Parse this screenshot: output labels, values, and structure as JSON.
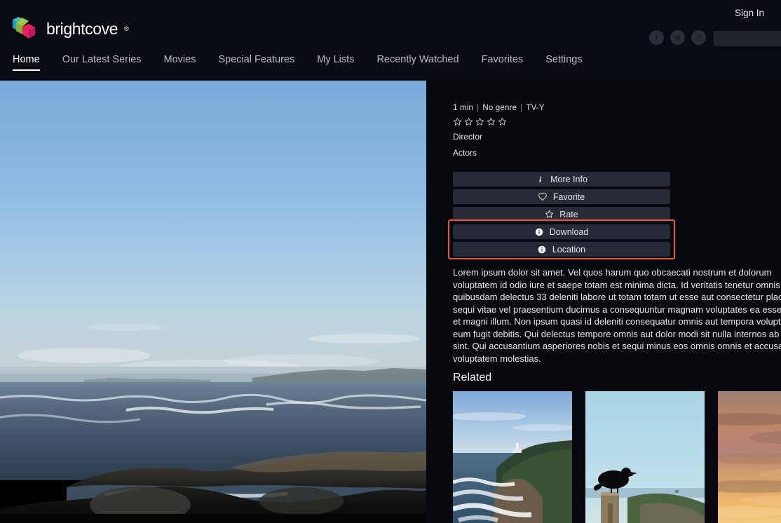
{
  "brand": {
    "name": "brightcove",
    "trademark": "®",
    "logo_colors": {
      "cyan": "#2dbde4",
      "green": "#9dc73c",
      "magenta": "#e61e64"
    }
  },
  "header": {
    "sign_in": "Sign In",
    "social": [
      {
        "name": "facebook-icon",
        "label": "Facebook"
      },
      {
        "name": "twitter-icon",
        "label": "Twitter"
      },
      {
        "name": "instagram-icon",
        "label": "Instagram"
      }
    ],
    "search": {
      "value": "",
      "placeholder": ""
    }
  },
  "nav": {
    "items": [
      {
        "label": "Home",
        "active": true
      },
      {
        "label": "Our Latest Series",
        "active": false
      },
      {
        "label": "Movies",
        "active": false
      },
      {
        "label": "Special Features",
        "active": false
      },
      {
        "label": "My Lists",
        "active": false
      },
      {
        "label": "Recently Watched",
        "active": false
      },
      {
        "label": "Favorites",
        "active": false
      },
      {
        "label": "Settings",
        "active": false
      }
    ]
  },
  "detail": {
    "duration": "1 min",
    "genre": "No genre",
    "rating": "TV-Y",
    "separator": "|",
    "star_count": 5,
    "stars_filled": 0,
    "director_label": "Director",
    "actors_label": "Actors",
    "actions": [
      {
        "label": "More Info",
        "icon": "info-italic-icon"
      },
      {
        "label": "Favorite",
        "icon": "heart-outline-icon"
      },
      {
        "label": "Rate",
        "icon": "star-outline-icon"
      },
      {
        "label": "Download",
        "icon": "info-circle-icon"
      },
      {
        "label": "Location",
        "icon": "info-circle-icon"
      }
    ],
    "highlight_color": "#ef5442",
    "description": "Lorem ipsum dolor sit amet. Vel quos harum quo obcaecati nostrum et dolorum voluptatem id odio iure et saepe totam est minima dicta. Id veritatis tenetur omnis sed quibusdam delectus 33 deleniti labore ut totam totam ut esse aut consectetur placeat. Et sequi vitae vel praesentium ducimus a consequuntur magnam voluptates ea esse eaque et magni illum. Non ipsum quasi id deleniti consequatur omnis aut tempora voluptatem eum fugit debitis. Qui delectus tempore omnis aut dolor modi sit nulla internos ab dolorem sint. Qui accusantium asperiores nobis et sequi minus eos omnis omnis et accusantium voluptatem molestias."
  },
  "related": {
    "title": "Related",
    "items": [
      {
        "name": "thumbnail-coastal-lighthouse",
        "scene": "coast"
      },
      {
        "name": "thumbnail-crow-on-post",
        "scene": "crow"
      },
      {
        "name": "thumbnail-orange-sunset",
        "scene": "sunset"
      }
    ]
  },
  "player": {
    "scene": "rocky-coast-at-dusk"
  }
}
